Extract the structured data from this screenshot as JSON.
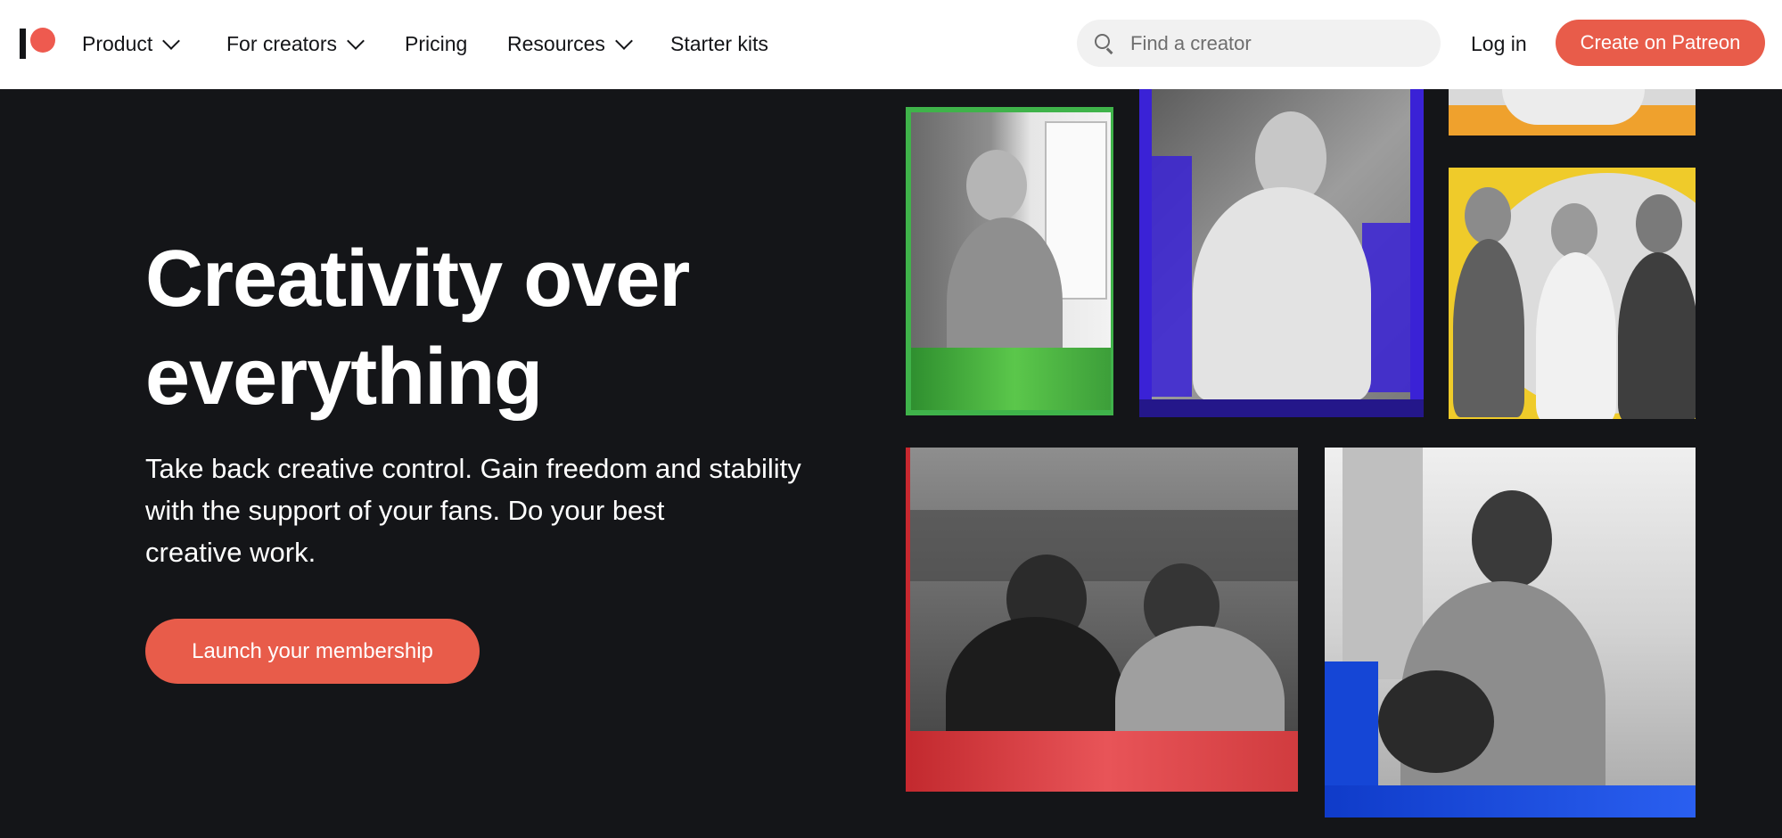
{
  "brand": {
    "name": "Patreon",
    "accent": "#e85c4a"
  },
  "nav": {
    "items": [
      {
        "label": "Product",
        "dropdown": true
      },
      {
        "label": "For creators",
        "dropdown": true
      },
      {
        "label": "Pricing",
        "dropdown": false
      },
      {
        "label": "Resources",
        "dropdown": true
      },
      {
        "label": "Starter kits",
        "dropdown": false
      }
    ],
    "search_placeholder": "Find a creator",
    "login_label": "Log in",
    "cta_label": "Create on Patreon"
  },
  "hero": {
    "title_line1": "Creativity over",
    "title_line2": "everything",
    "subtitle_line1": "Take back creative control. Gain freedom and stability",
    "subtitle_line2": "with the support of your fans. Do your best",
    "subtitle_line3": "creative work.",
    "cta_label": "Launch your membership"
  },
  "icons": {
    "logo": "patreon-logo",
    "chevron": "chevron-down-icon",
    "search": "search-icon"
  }
}
